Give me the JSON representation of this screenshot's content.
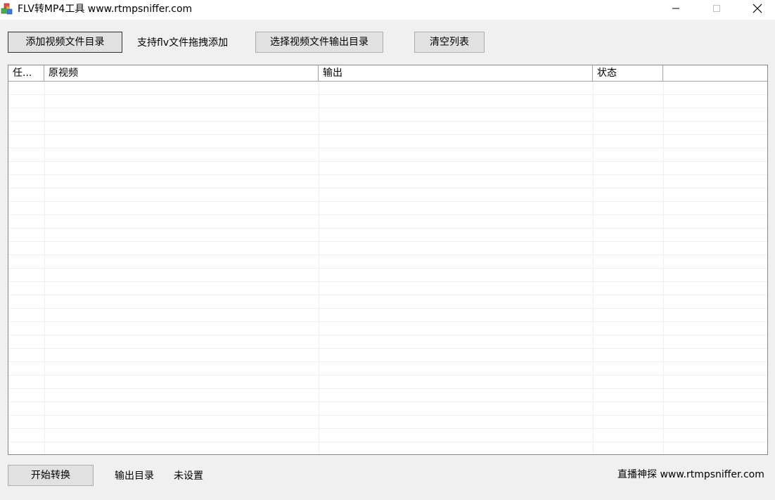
{
  "window": {
    "title": "FLV转MP4工具 www.rtmpsniffer.com"
  },
  "toolbar": {
    "add_dir_label": "添加视频文件目录",
    "drag_hint": "支持flv文件拖拽添加",
    "select_output_label": "选择视频文件输出目录",
    "clear_label": "清空列表"
  },
  "list": {
    "columns": [
      "任...",
      "原视频",
      "输出",
      "状态",
      ""
    ]
  },
  "footer": {
    "start_label": "开始转换",
    "output_dir_label": "输出目录",
    "output_dir_value": "未设置",
    "credit": "直播神探 www.rtmpsniffer.com"
  },
  "icons": {
    "app": "app-cubes-icon",
    "minimize": "minimize-icon",
    "maximize": "maximize-icon",
    "close": "close-icon"
  }
}
